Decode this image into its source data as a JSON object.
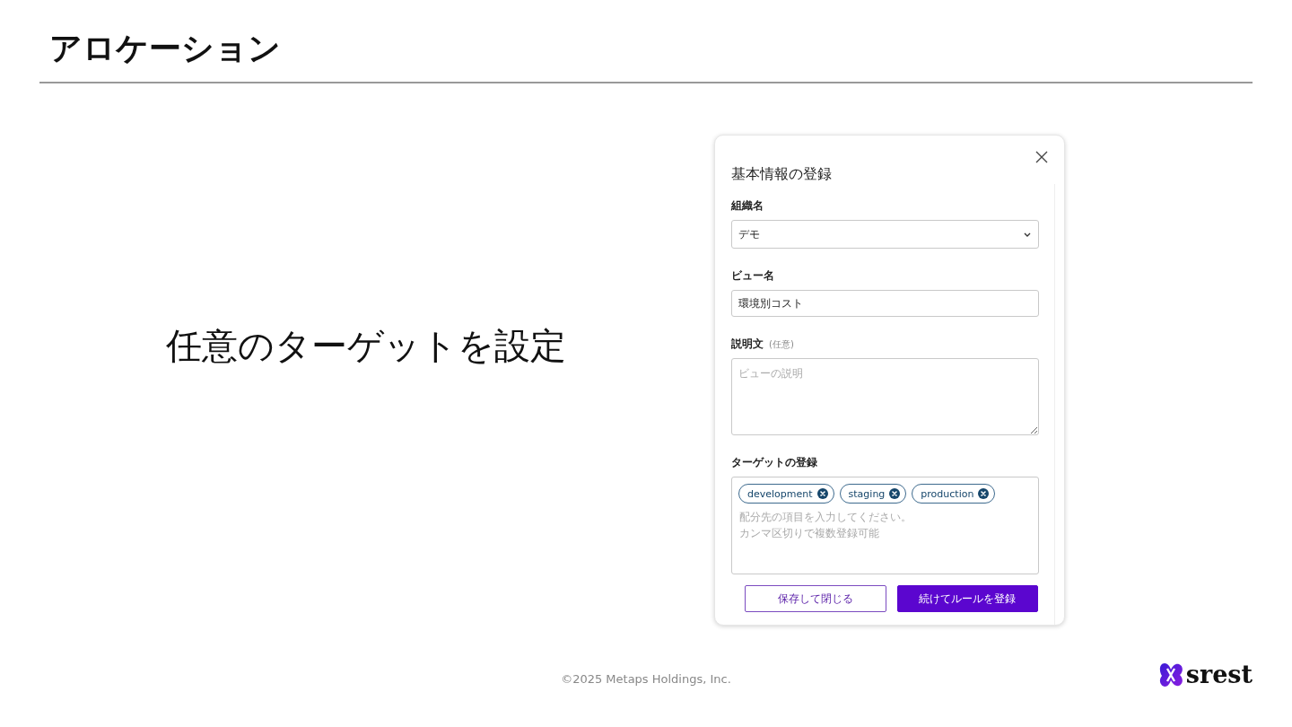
{
  "slide": {
    "title": "アロケーション",
    "caption": "任意のターゲットを設定",
    "footer": "©2025 Metaps Holdings, Inc.",
    "logo_text": "srest"
  },
  "dialog": {
    "title": "基本情報の登録",
    "fields": [
      {
        "kind": "select",
        "label": "組織名",
        "value": "デモ"
      },
      {
        "kind": "text",
        "label": "ビュー名",
        "value": "環境別コスト"
      },
      {
        "kind": "textarea",
        "label": "説明文",
        "hint": "(任意)",
        "placeholder": "ビューの説明"
      },
      {
        "kind": "tags",
        "label": "ターゲットの登録",
        "tags": [
          "development",
          "staging",
          "production"
        ],
        "placeholder": "配分先の項目を入力してください。カンマ区切りで複数登録可能"
      }
    ],
    "buttons": [
      {
        "kind": "secondary",
        "label": "保存して閉じる"
      },
      {
        "kind": "primary",
        "label": "続けてルールを登録"
      }
    ]
  }
}
